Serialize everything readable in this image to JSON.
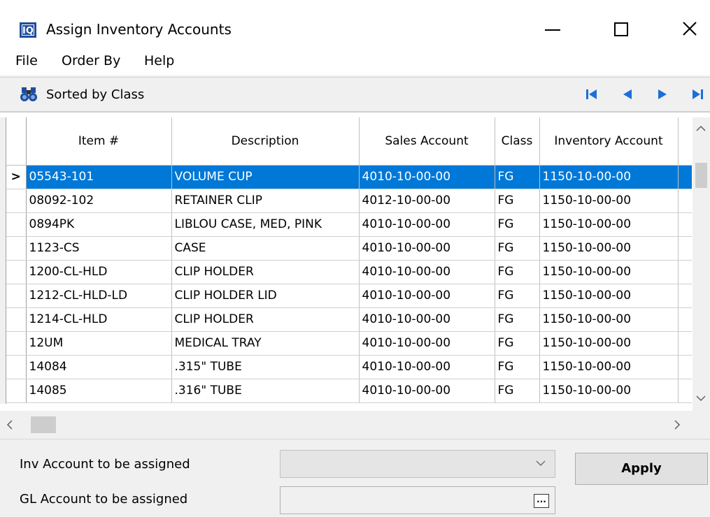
{
  "window": {
    "app_icon_text": "IQ",
    "title": "Assign Inventory Accounts"
  },
  "menu": [
    "File",
    "Order By",
    "Help"
  ],
  "toolbar": {
    "sort_label": "Sorted by Class",
    "nav": [
      "first-record-icon",
      "prior-record-icon",
      "next-record-icon",
      "last-record-icon"
    ]
  },
  "grid": {
    "columns": [
      "Item #",
      "Description",
      "Sales Account",
      "Class",
      "Inventory Account"
    ],
    "selected_row": 0,
    "current_row_indicator": ">",
    "rows": [
      [
        "05543-101",
        "VOLUME CUP",
        "4010-10-00-00",
        "FG",
        "1150-10-00-00"
      ],
      [
        "08092-102",
        "RETAINER CLIP",
        "4012-10-00-00",
        "FG",
        "1150-10-00-00"
      ],
      [
        "0894PK",
        "LIBLOU CASE, MED, PINK",
        "4010-10-00-00",
        "FG",
        "1150-10-00-00"
      ],
      [
        "1123-CS",
        "CASE",
        "4010-10-00-00",
        "FG",
        "1150-10-00-00"
      ],
      [
        "1200-CL-HLD",
        "CLIP HOLDER",
        "4010-10-00-00",
        "FG",
        "1150-10-00-00"
      ],
      [
        "1212-CL-HLD-LD",
        "CLIP HOLDER LID",
        "4010-10-00-00",
        "FG",
        "1150-10-00-00"
      ],
      [
        "1214-CL-HLD",
        "CLIP HOLDER",
        "4010-10-00-00",
        "FG",
        "1150-10-00-00"
      ],
      [
        "12UM",
        "MEDICAL TRAY",
        "4010-10-00-00",
        "FG",
        "1150-10-00-00"
      ],
      [
        "14084",
        ".315\" TUBE",
        "4010-10-00-00",
        "FG",
        "1150-10-00-00"
      ],
      [
        "14085",
        ".316\" TUBE",
        "4010-10-00-00",
        "FG",
        "1150-10-00-00"
      ]
    ]
  },
  "form": {
    "inv_account_label": "Inv Account to be assigned",
    "inv_account_value": "",
    "gl_account_label": "GL Account to be assigned",
    "gl_account_value": "",
    "ellipsis": "...",
    "apply_label": "Apply"
  },
  "colors": {
    "selection": "#0078d7",
    "nav_arrows": "#1a6fd8",
    "app_icon": "#1f4e9c"
  }
}
